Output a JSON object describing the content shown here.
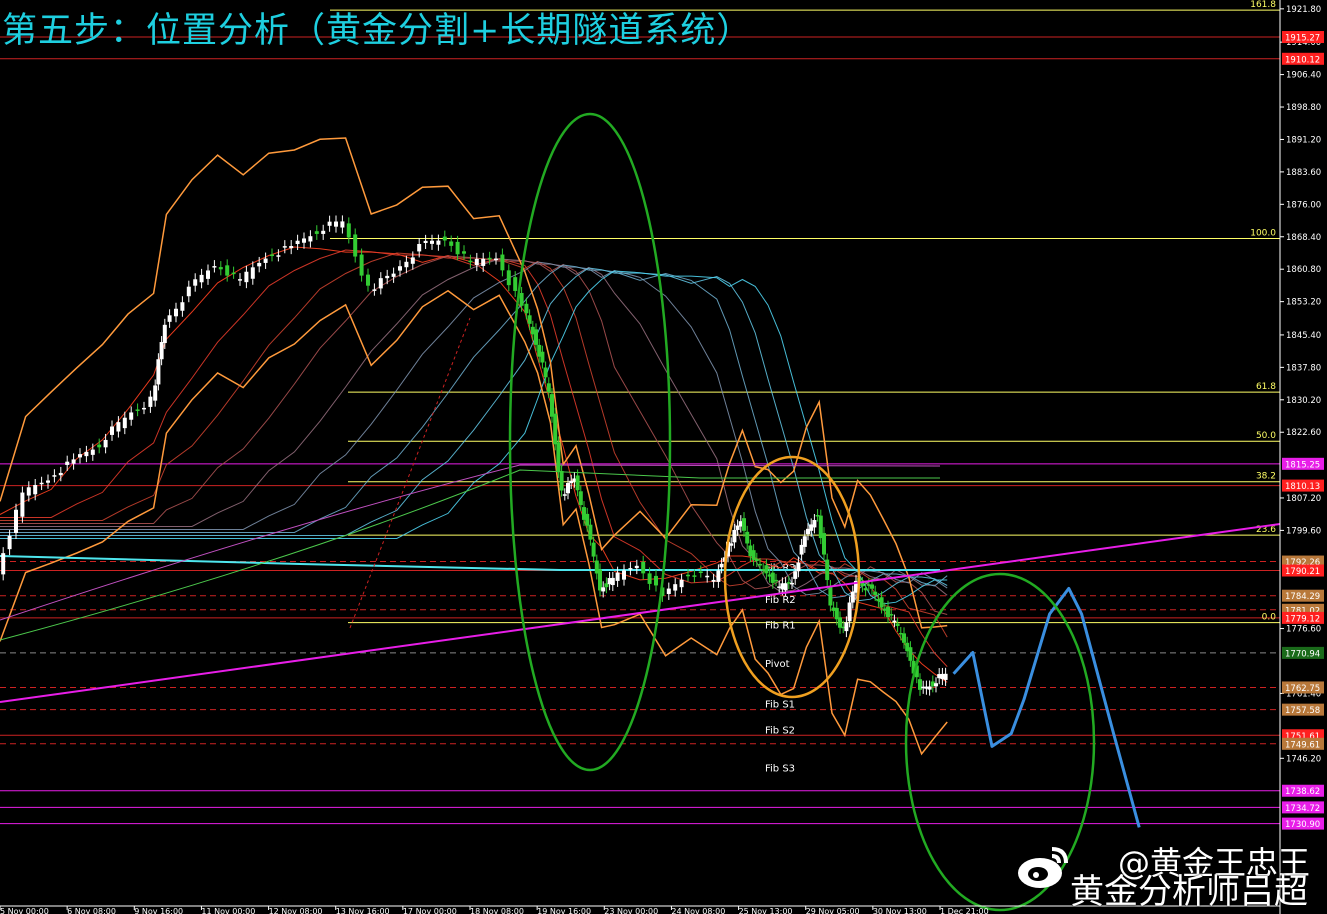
{
  "header": {
    "title": "第五步：位置分析（黄金分割+长期隧道系统）"
  },
  "watermark": {
    "line1": "@黄金王忠王",
    "line2": "黄金分析师吕超"
  },
  "colors": {
    "background": "#000000",
    "price_axis": "#ffffff",
    "title": "#1ecfe0",
    "bollinger": "#ff9a3c",
    "trendline": "#e81ee8",
    "forecast": "#3a8fe0",
    "fib_level": "#ffff66",
    "green_ellipse": "#22aa22",
    "orange_ellipse": "#f0a020",
    "candle_bull": "#ffffff",
    "candle_bear": "#33cc33"
  },
  "chart_data": {
    "type": "candlestick",
    "symbol_context": "XAUUSD H4",
    "ylim": [
      1713.0,
      1922.0
    ],
    "y_ticks": [
      "1921.80",
      "1914.00",
      "1906.40",
      "1898.80",
      "1891.20",
      "1883.60",
      "1876.00",
      "1868.40",
      "1860.80",
      "1853.20",
      "1845.40",
      "1837.80",
      "1830.20",
      "1822.60",
      "1807.20",
      "1799.60",
      "1776.60",
      "1761.40",
      "1746.20"
    ],
    "x_ticks": [
      "5 Nov 00:00",
      "6 Nov 08:00",
      "9 Nov 16:00",
      "11 Nov 00:00",
      "12 Nov 08:00",
      "13 Nov 16:00",
      "17 Nov 00:00",
      "18 Nov 08:00",
      "19 Nov 16:00",
      "23 Nov 00:00",
      "24 Nov 08:00",
      "25 Nov 13:00",
      "29 Nov 05:00",
      "30 Nov 13:00",
      "1 Dec 21:00"
    ],
    "x_tick_labels": [
      "5 Nov 00:00",
      "6 Nov 08:00",
      "9 Nov 16:00",
      "11 Nov 00:00",
      "12 Nov 08:00",
      "13 Nov 16:00",
      "17 Nov 00:00",
      "18 Nov 08:00",
      "19 Nov 16:00",
      "23 Nov 00:00",
      "24 Nov 08:00",
      "25 Nov 13:00",
      "29 Nov 05:00",
      "30 Nov 13:00",
      "1 Dec 21:00"
    ],
    "price_labels": [
      {
        "value": 1915.2,
        "text": "1915.27",
        "color": "#ff2020"
      },
      {
        "value": 1910.1,
        "text": "1910.12",
        "color": "#ff2020"
      },
      {
        "value": 1815.2,
        "text": "1815.25",
        "color": "#e81ee8"
      },
      {
        "value": 1810.1,
        "text": "1810.13",
        "color": "#ff2020"
      },
      {
        "value": 1792.3,
        "text": "1792.26",
        "color": "#b8783a"
      },
      {
        "value": 1790.2,
        "text": "1790.21",
        "color": "#ff2020"
      },
      {
        "value": 1784.3,
        "text": "1784.29",
        "color": "#b8783a"
      },
      {
        "value": 1781.0,
        "text": "1781.02",
        "color": "#b8783a"
      },
      {
        "value": 1779.1,
        "text": "1779.12",
        "color": "#ff2020"
      },
      {
        "value": 1770.9,
        "text": "1770.94",
        "color": "#ffffff"
      },
      {
        "value": 1762.8,
        "text": "1762.75",
        "color": "#b8783a"
      },
      {
        "value": 1757.6,
        "text": "1757.58",
        "color": "#b8783a"
      },
      {
        "value": 1751.6,
        "text": "1751.61",
        "color": "#ff2020"
      },
      {
        "value": 1749.6,
        "text": "1749.61",
        "color": "#b8783a"
      },
      {
        "value": 1738.6,
        "text": "1738.62",
        "color": "#e81ee8"
      },
      {
        "value": 1734.7,
        "text": "1734.72",
        "color": "#e81ee8"
      },
      {
        "value": 1730.9,
        "text": "1730.90",
        "color": "#e81ee8"
      }
    ],
    "fibonacci": [
      {
        "label": "161.8",
        "value": 1921.5
      },
      {
        "label": "100.0",
        "value": 1868.0
      },
      {
        "label": "61.8",
        "value": 1832.0
      },
      {
        "label": "50.0",
        "value": 1820.5
      },
      {
        "label": "38.2",
        "value": 1811.0
      },
      {
        "label": "23.6",
        "value": 1798.5
      },
      {
        "label": "0.0",
        "value": 1778.0
      }
    ],
    "pivot_levels": [
      {
        "label": "Fib R3",
        "value": 1791.0
      },
      {
        "label": "Fib R2",
        "value": 1783.5
      },
      {
        "label": "Fib R1",
        "value": 1777.5
      },
      {
        "label": "Pivot",
        "value": 1768.5
      },
      {
        "label": "Fib S1",
        "value": 1759.0
      },
      {
        "label": "Fib S2",
        "value": 1753.0
      },
      {
        "label": "Fib S3",
        "value": 1744.0
      }
    ],
    "close_path": [
      {
        "x": 0.0,
        "y": 1790
      },
      {
        "x": 0.02,
        "y": 1808
      },
      {
        "x": 0.04,
        "y": 1812
      },
      {
        "x": 0.06,
        "y": 1816
      },
      {
        "x": 0.08,
        "y": 1820
      },
      {
        "x": 0.1,
        "y": 1826
      },
      {
        "x": 0.12,
        "y": 1830
      },
      {
        "x": 0.13,
        "y": 1848
      },
      {
        "x": 0.15,
        "y": 1856
      },
      {
        "x": 0.17,
        "y": 1862
      },
      {
        "x": 0.19,
        "y": 1858
      },
      {
        "x": 0.21,
        "y": 1864
      },
      {
        "x": 0.23,
        "y": 1866
      },
      {
        "x": 0.25,
        "y": 1870
      },
      {
        "x": 0.27,
        "y": 1872
      },
      {
        "x": 0.29,
        "y": 1856
      },
      {
        "x": 0.31,
        "y": 1860
      },
      {
        "x": 0.33,
        "y": 1866
      },
      {
        "x": 0.35,
        "y": 1868
      },
      {
        "x": 0.37,
        "y": 1862
      },
      {
        "x": 0.39,
        "y": 1864
      },
      {
        "x": 0.41,
        "y": 1852
      },
      {
        "x": 0.42,
        "y": 1844
      },
      {
        "x": 0.43,
        "y": 1832
      },
      {
        "x": 0.44,
        "y": 1808
      },
      {
        "x": 0.45,
        "y": 1812
      },
      {
        "x": 0.46,
        "y": 1800
      },
      {
        "x": 0.47,
        "y": 1786
      },
      {
        "x": 0.48,
        "y": 1788
      },
      {
        "x": 0.5,
        "y": 1792
      },
      {
        "x": 0.52,
        "y": 1784
      },
      {
        "x": 0.54,
        "y": 1790
      },
      {
        "x": 0.56,
        "y": 1788
      },
      {
        "x": 0.57,
        "y": 1796
      },
      {
        "x": 0.58,
        "y": 1802
      },
      {
        "x": 0.59,
        "y": 1792
      },
      {
        "x": 0.6,
        "y": 1790
      },
      {
        "x": 0.61,
        "y": 1786
      },
      {
        "x": 0.62,
        "y": 1788
      },
      {
        "x": 0.63,
        "y": 1798
      },
      {
        "x": 0.64,
        "y": 1804
      },
      {
        "x": 0.65,
        "y": 1782
      },
      {
        "x": 0.66,
        "y": 1776
      },
      {
        "x": 0.67,
        "y": 1788
      },
      {
        "x": 0.68,
        "y": 1786
      },
      {
        "x": 0.69,
        "y": 1782
      },
      {
        "x": 0.7,
        "y": 1778
      },
      {
        "x": 0.71,
        "y": 1772
      },
      {
        "x": 0.72,
        "y": 1762
      },
      {
        "x": 0.73,
        "y": 1764
      },
      {
        "x": 0.74,
        "y": 1766
      }
    ],
    "forecast_path": [
      {
        "x": 0.745,
        "y": 1766
      },
      {
        "x": 0.76,
        "y": 1771
      },
      {
        "x": 0.775,
        "y": 1749
      },
      {
        "x": 0.79,
        "y": 1752
      },
      {
        "x": 0.8,
        "y": 1760
      },
      {
        "x": 0.82,
        "y": 1780
      },
      {
        "x": 0.835,
        "y": 1786
      },
      {
        "x": 0.845,
        "y": 1780
      },
      {
        "x": 0.87,
        "y": 1752
      },
      {
        "x": 0.89,
        "y": 1730
      }
    ]
  }
}
